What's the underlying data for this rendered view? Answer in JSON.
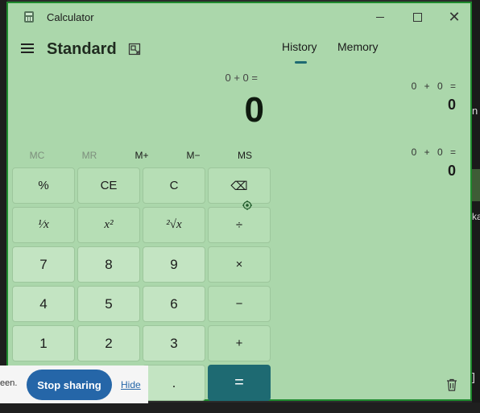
{
  "titlebar": {
    "title": "Calculator"
  },
  "header": {
    "mode": "Standard"
  },
  "display": {
    "expression": "0 + 0 =",
    "value": "0"
  },
  "memory": [
    "MC",
    "MR",
    "M+",
    "M−",
    "MS"
  ],
  "keys": {
    "percent": "%",
    "ce": "CE",
    "c": "C",
    "backspace": "⌫",
    "reciprocal": "¹⁄x",
    "square": "x²",
    "sqrt": "²√x",
    "divide": "÷",
    "seven": "7",
    "eight": "8",
    "nine": "9",
    "multiply": "×",
    "four": "4",
    "five": "5",
    "six": "6",
    "minus": "−",
    "one": "1",
    "two": "2",
    "three": "3",
    "plus": "+",
    "decimal": ".",
    "equals": "="
  },
  "tabs": {
    "history": "History",
    "memory": "Memory"
  },
  "history": [
    {
      "expression": "0 + 0 =",
      "result": "0"
    },
    {
      "expression": "0 + 0 =",
      "result": "0"
    }
  ],
  "share": {
    "partial_text": "een.",
    "stop_label": "Stop sharing",
    "hide_label": "Hide"
  },
  "background": {
    "right_text_1": "n",
    "right_text_2": "ka",
    "right_icon": "]"
  },
  "colors": {
    "window_bg": "#abd7ab",
    "accent": "#1e6a72",
    "border": "#1f8a2e",
    "share_button": "#2566a8"
  },
  "icons": [
    "calculator-app-icon",
    "hamburger-menu-icon",
    "keep-on-top-icon",
    "minimize-icon",
    "maximize-icon",
    "close-icon",
    "backspace-icon",
    "trash-icon",
    "target-cursor-icon"
  ]
}
